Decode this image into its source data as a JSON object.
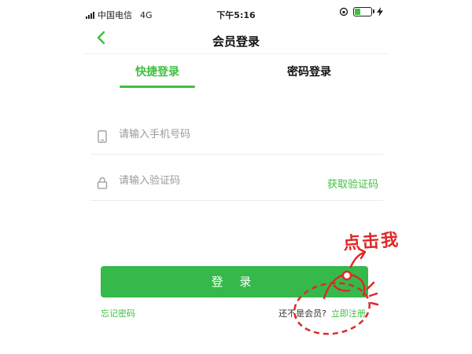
{
  "status_bar": {
    "carrier": "中国电信",
    "network": "4G",
    "time": "下午5:16"
  },
  "header": {
    "title": "会员登录",
    "back_icon": "chevron-left-icon"
  },
  "tabs": [
    {
      "label": "快捷登录",
      "active": true
    },
    {
      "label": "密码登录",
      "active": false
    }
  ],
  "form": {
    "phone_placeholder": "请输入手机号码",
    "code_placeholder": "请输入验证码",
    "get_code_label": "获取验证码"
  },
  "login_button": "登 录",
  "footer": {
    "forgot_label": "忘记密码",
    "register_question": "还不是会员?",
    "register_link": "立即注册"
  },
  "annotation": {
    "text": "点击我",
    "color": "#e02828"
  },
  "colors": {
    "accent": "#3fbf3f",
    "button": "#35b94a"
  }
}
